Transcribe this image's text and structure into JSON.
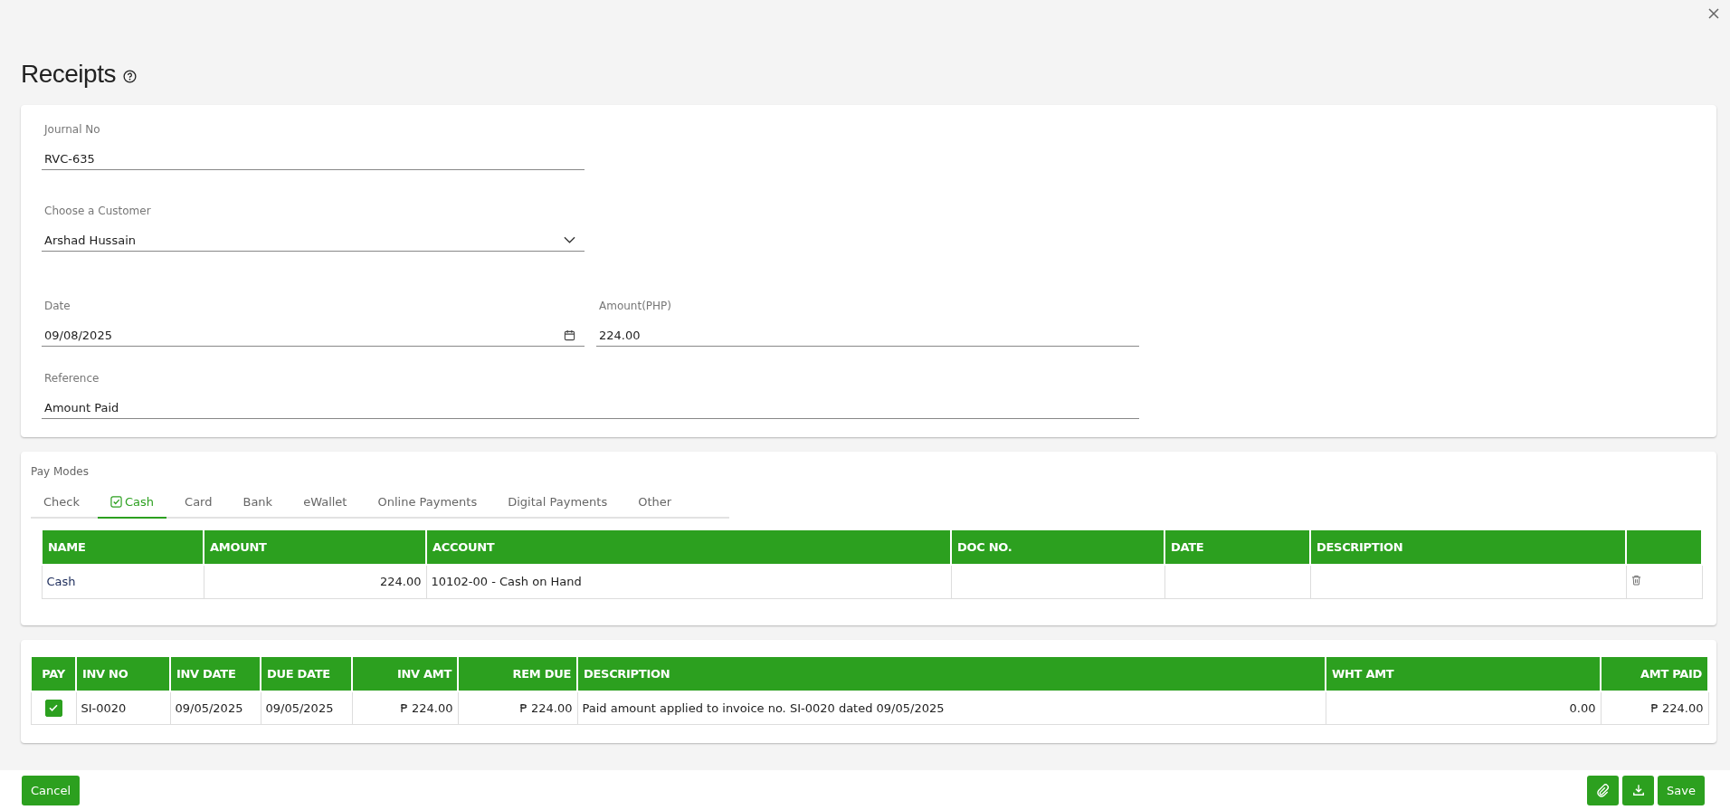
{
  "page": {
    "title": "Receipts"
  },
  "details": {
    "rows": [
      [
        {
          "kind": "text",
          "label": "Journal No",
          "value": "RVC-635"
        }
      ],
      [
        {
          "kind": "select",
          "label": "Choose a Customer",
          "value": "Arshad Hussain"
        }
      ],
      [
        {
          "kind": "date",
          "label": "Date",
          "value": "09/08/2025"
        },
        {
          "kind": "text",
          "label": "Amount(PHP)",
          "value": "224.00"
        }
      ],
      [
        {
          "kind": "note",
          "label": "Reference",
          "value": "Amount Paid"
        }
      ]
    ]
  },
  "pay_modes": {
    "title": "Pay Modes",
    "tabs": [
      {
        "label": "Check",
        "selected": false
      },
      {
        "label": "Cash",
        "selected": true
      },
      {
        "label": "Card",
        "selected": false
      },
      {
        "label": "Bank",
        "selected": false
      },
      {
        "label": "eWallet",
        "selected": false
      },
      {
        "label": "Online Payments",
        "selected": false
      },
      {
        "label": "Digital Payments",
        "selected": false
      },
      {
        "label": "Other",
        "selected": false
      }
    ],
    "columns": [
      "NAME",
      "AMOUNT",
      "ACCOUNT",
      "DOC NO.",
      "DATE",
      "DESCRIPTION"
    ],
    "rows": [
      {
        "cells": [
          "Cash",
          "224.00",
          "10102-00 - Cash on Hand",
          "",
          "",
          ""
        ]
      }
    ]
  },
  "invoices": {
    "columns": [
      "PAY",
      "INV NO",
      "INV DATE",
      "DUE DATE",
      "INV AMT",
      "REM DUE",
      "DESCRIPTION",
      "WHT AMT",
      "AMT PAID"
    ],
    "rows": [
      {
        "pay": true,
        "cells": [
          "",
          "SI-0020",
          "09/05/2025",
          "09/05/2025",
          "₱ 224.00",
          "₱ 224.00",
          "Paid amount applied to invoice no. SI-0020 dated 09/05/2025",
          "0.00",
          "₱ 224.00"
        ]
      }
    ]
  },
  "footer": {
    "cancel": "Cancel",
    "actions": [
      {
        "kind": "attach"
      },
      {
        "kind": "download"
      },
      {
        "kind": "text",
        "label": "Save"
      }
    ]
  }
}
